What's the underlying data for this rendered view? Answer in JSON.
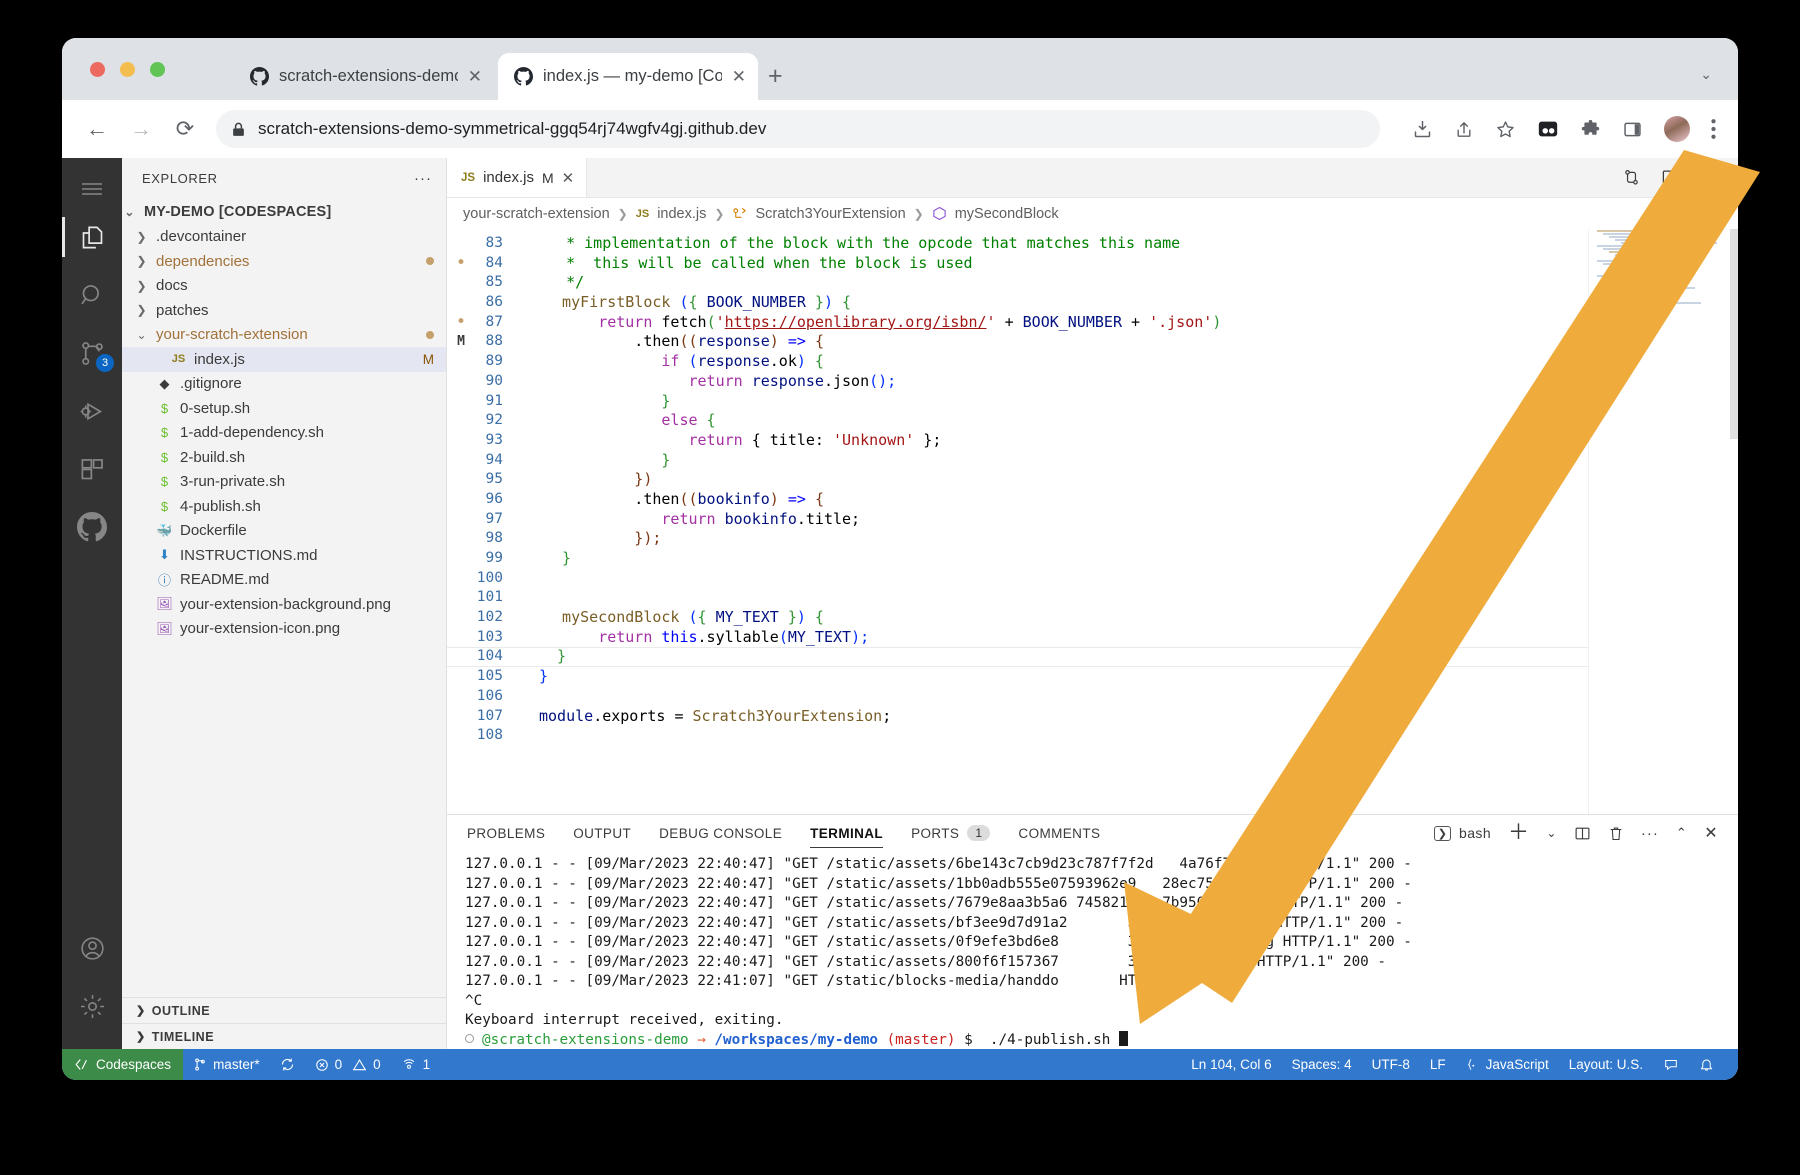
{
  "browser": {
    "tabs": [
      {
        "title": "scratch-extensions-demo/my-d",
        "active": false
      },
      {
        "title": "index.js — my-demo [Codespa",
        "active": true
      }
    ],
    "new_tab_label": "+",
    "tab_close_label": "✕",
    "tab_list_icon": "chevron-down-icon",
    "back_label": "←",
    "forward_label": "→",
    "reload_label": "⟳",
    "lock_icon": "lock-icon",
    "url": "scratch-extensions-demo-symmetrical-ggq54rj74wgfv4gj.github.dev",
    "toolbar_icons": [
      "download-icon",
      "share-icon",
      "bookmark-star-icon",
      "extension-dark-icon",
      "puzzle-icon",
      "sidepanel-icon",
      "avatar",
      "kebab-menu-icon"
    ]
  },
  "activity_bar": {
    "items": [
      {
        "name": "menu",
        "icon": "hamburger-icon",
        "active": false,
        "badge": null
      },
      {
        "name": "explorer",
        "icon": "files-icon",
        "active": true,
        "badge": null
      },
      {
        "name": "search",
        "icon": "search-icon",
        "active": false,
        "badge": null
      },
      {
        "name": "source-control",
        "icon": "source-control-icon",
        "active": false,
        "badge": "3"
      },
      {
        "name": "run-and-debug",
        "icon": "run-debug-icon",
        "active": false,
        "badge": null
      },
      {
        "name": "extensions",
        "icon": "extensions-icon",
        "active": false,
        "badge": null
      },
      {
        "name": "github",
        "icon": "github-icon",
        "active": false,
        "badge": null
      }
    ],
    "bottom_items": [
      {
        "name": "accounts",
        "icon": "account-icon"
      },
      {
        "name": "settings",
        "icon": "gear-icon"
      }
    ]
  },
  "sidebar": {
    "title": "EXPLORER",
    "more_actions": "···",
    "root": "MY-DEMO [CODESPACES]",
    "items": [
      {
        "label": ".devcontainer",
        "type": "folder",
        "expanded": false,
        "indent": 1,
        "icon": "folder",
        "color": "#3b3b3b",
        "badge": null
      },
      {
        "label": "dependencies",
        "type": "folder",
        "expanded": false,
        "indent": 1,
        "icon": "folder",
        "color": "#a1713a",
        "badge": "dirty"
      },
      {
        "label": "docs",
        "type": "folder",
        "expanded": false,
        "indent": 1,
        "icon": "folder",
        "color": "#3b3b3b",
        "badge": null
      },
      {
        "label": "patches",
        "type": "folder",
        "expanded": false,
        "indent": 1,
        "icon": "folder",
        "color": "#3b3b3b",
        "badge": null
      },
      {
        "label": "your-scratch-extension",
        "type": "folder",
        "expanded": true,
        "indent": 1,
        "icon": "folder",
        "color": "#a1713a",
        "badge": "dirty"
      },
      {
        "label": "index.js",
        "type": "file",
        "indent": 2,
        "icon": "js-icon",
        "color": "#3b3b3b",
        "badge": "M",
        "selected": true
      },
      {
        "label": ".gitignore",
        "type": "file",
        "indent": 1,
        "icon": "git-icon",
        "color": "#3b3b3b",
        "badge": null
      },
      {
        "label": "0-setup.sh",
        "type": "file",
        "indent": 1,
        "icon": "shell-icon",
        "color": "#3b3b3b",
        "badge": null
      },
      {
        "label": "1-add-dependency.sh",
        "type": "file",
        "indent": 1,
        "icon": "shell-icon",
        "color": "#3b3b3b",
        "badge": null
      },
      {
        "label": "2-build.sh",
        "type": "file",
        "indent": 1,
        "icon": "shell-icon",
        "color": "#3b3b3b",
        "badge": null
      },
      {
        "label": "3-run-private.sh",
        "type": "file",
        "indent": 1,
        "icon": "shell-icon",
        "color": "#3b3b3b",
        "badge": null
      },
      {
        "label": "4-publish.sh",
        "type": "file",
        "indent": 1,
        "icon": "shell-icon",
        "color": "#3b3b3b",
        "badge": null
      },
      {
        "label": "Dockerfile",
        "type": "file",
        "indent": 1,
        "icon": "docker-icon",
        "color": "#3b3b3b",
        "badge": null
      },
      {
        "label": "INSTRUCTIONS.md",
        "type": "file",
        "indent": 1,
        "icon": "markdown-icon",
        "color": "#3b3b3b",
        "badge": null
      },
      {
        "label": "README.md",
        "type": "file",
        "indent": 1,
        "icon": "info-icon",
        "color": "#3b3b3b",
        "badge": null
      },
      {
        "label": "your-extension-background.png",
        "type": "file",
        "indent": 1,
        "icon": "image-icon",
        "color": "#3b3b3b",
        "badge": null
      },
      {
        "label": "your-extension-icon.png",
        "type": "file",
        "indent": 1,
        "icon": "image-icon",
        "color": "#3b3b3b",
        "badge": null
      }
    ],
    "sections": [
      {
        "label": "OUTLINE",
        "expanded": false
      },
      {
        "label": "TIMELINE",
        "expanded": false
      }
    ]
  },
  "editor": {
    "tab": {
      "filename": "index.js",
      "badge": "M",
      "close": "✕",
      "lang_icon": "JS"
    },
    "actions": [
      "split-editor-icon",
      "more-actions-icon"
    ],
    "breadcrumb": [
      "your-scratch-extension",
      "index.js",
      "Scratch3YourExtension",
      "mySecondBlock"
    ],
    "first_line": 83,
    "current_line": 104,
    "lines": [
      {
        "n": 83,
        "gutter": "",
        "indent": 0,
        "tokens": [
          {
            "t": "   * implementation of the block with the opcode that matches this name",
            "c": "c-com"
          }
        ]
      },
      {
        "n": 84,
        "gutter": "•",
        "indent": 0,
        "tokens": [
          {
            "t": "   *  this will be called when the block is used",
            "c": "c-com"
          }
        ]
      },
      {
        "n": 85,
        "gutter": "",
        "indent": 0,
        "tokens": [
          {
            "t": "   */",
            "c": "c-com"
          }
        ]
      },
      {
        "n": 86,
        "gutter": "",
        "indent": 1,
        "tokens": [
          {
            "t": "  myFirstBlock ",
            "c": "c-fn"
          },
          {
            "t": "(",
            "c": "c-brk1"
          },
          {
            "t": "{ ",
            "c": "c-brk2"
          },
          {
            "t": "BOOK_NUMBER",
            "c": "c-var"
          },
          {
            "t": " }",
            "c": "c-brk2"
          },
          {
            "t": ")",
            "c": "c-brk1"
          },
          {
            "t": " {",
            "c": "c-brk2"
          }
        ]
      },
      {
        "n": 87,
        "gutter": "•",
        "indent": 1,
        "tokens": [
          {
            "t": "      ",
            "c": "c-pl"
          },
          {
            "t": "return",
            "c": "c-kw"
          },
          {
            "t": " fetch",
            "c": "c-pl"
          },
          {
            "t": "(",
            "c": "c-brk2"
          },
          {
            "t": "'",
            "c": "c-str"
          },
          {
            "t": "https://openlibrary.org/isbn/",
            "c": "c-url"
          },
          {
            "t": "'",
            "c": "c-str"
          },
          {
            "t": " + ",
            "c": "c-pl"
          },
          {
            "t": "BOOK_NUMBER",
            "c": "c-var"
          },
          {
            "t": " + ",
            "c": "c-pl"
          },
          {
            "t": "'.json'",
            "c": "c-str"
          },
          {
            "t": ")",
            "c": "c-brk2"
          }
        ]
      },
      {
        "n": 88,
        "gutter": "M",
        "indent": 1,
        "tokens": [
          {
            "t": "          .then",
            "c": "c-pl"
          },
          {
            "t": "((",
            "c": "c-brk3"
          },
          {
            "t": "response",
            "c": "c-var"
          },
          {
            "t": ")",
            "c": "c-brk3"
          },
          {
            "t": " => ",
            "c": "c-kw2"
          },
          {
            "t": "{",
            "c": "c-brk3"
          }
        ]
      },
      {
        "n": 89,
        "gutter": "",
        "indent": 1,
        "tokens": [
          {
            "t": "             ",
            "c": "c-pl"
          },
          {
            "t": "if",
            "c": "c-kw"
          },
          {
            "t": " (",
            "c": "c-brk1"
          },
          {
            "t": "response",
            "c": "c-var"
          },
          {
            "t": ".ok",
            "c": "c-pl"
          },
          {
            "t": ")",
            "c": "c-brk1"
          },
          {
            "t": " {",
            "c": "c-brk2"
          }
        ]
      },
      {
        "n": 90,
        "gutter": "",
        "indent": 1,
        "tokens": [
          {
            "t": "                ",
            "c": "c-pl"
          },
          {
            "t": "return",
            "c": "c-kw"
          },
          {
            "t": " ",
            "c": "c-pl"
          },
          {
            "t": "response",
            "c": "c-var"
          },
          {
            "t": ".json",
            "c": "c-pl"
          },
          {
            "t": "();",
            "c": "c-brk1"
          }
        ]
      },
      {
        "n": 91,
        "gutter": "",
        "indent": 1,
        "tokens": [
          {
            "t": "             }",
            "c": "c-brk2"
          }
        ]
      },
      {
        "n": 92,
        "gutter": "",
        "indent": 1,
        "tokens": [
          {
            "t": "             ",
            "c": "c-pl"
          },
          {
            "t": "else",
            "c": "c-kw"
          },
          {
            "t": " {",
            "c": "c-brk2"
          }
        ]
      },
      {
        "n": 93,
        "gutter": "",
        "indent": 1,
        "tokens": [
          {
            "t": "                ",
            "c": "c-pl"
          },
          {
            "t": "return",
            "c": "c-kw"
          },
          {
            "t": " { title: ",
            "c": "c-pl"
          },
          {
            "t": "'Unknown'",
            "c": "c-str"
          },
          {
            "t": " };",
            "c": "c-pl"
          }
        ]
      },
      {
        "n": 94,
        "gutter": "",
        "indent": 1,
        "tokens": [
          {
            "t": "             }",
            "c": "c-brk2"
          }
        ]
      },
      {
        "n": 95,
        "gutter": "",
        "indent": 1,
        "tokens": [
          {
            "t": "          })",
            "c": "c-brk3"
          }
        ]
      },
      {
        "n": 96,
        "gutter": "",
        "indent": 1,
        "tokens": [
          {
            "t": "          .then",
            "c": "c-pl"
          },
          {
            "t": "((",
            "c": "c-brk3"
          },
          {
            "t": "bookinfo",
            "c": "c-var"
          },
          {
            "t": ")",
            "c": "c-brk3"
          },
          {
            "t": " => ",
            "c": "c-kw2"
          },
          {
            "t": "{",
            "c": "c-brk3"
          }
        ]
      },
      {
        "n": 97,
        "gutter": "",
        "indent": 1,
        "tokens": [
          {
            "t": "             ",
            "c": "c-pl"
          },
          {
            "t": "return",
            "c": "c-kw"
          },
          {
            "t": " ",
            "c": "c-pl"
          },
          {
            "t": "bookinfo",
            "c": "c-var"
          },
          {
            "t": ".title;",
            "c": "c-pl"
          }
        ]
      },
      {
        "n": 98,
        "gutter": "",
        "indent": 1,
        "tokens": [
          {
            "t": "          });",
            "c": "c-brk3"
          }
        ]
      },
      {
        "n": 99,
        "gutter": "",
        "indent": 1,
        "tokens": [
          {
            "t": "  }",
            "c": "c-brk2"
          }
        ]
      },
      {
        "n": 100,
        "gutter": "",
        "indent": 1,
        "tokens": [
          {
            "t": "",
            "c": "c-pl"
          }
        ]
      },
      {
        "n": 101,
        "gutter": "",
        "indent": 1,
        "tokens": [
          {
            "t": "",
            "c": "c-pl"
          }
        ]
      },
      {
        "n": 102,
        "gutter": "",
        "indent": 1,
        "tokens": [
          {
            "t": "  mySecondBlock ",
            "c": "c-fn"
          },
          {
            "t": "(",
            "c": "c-brk1"
          },
          {
            "t": "{ ",
            "c": "c-brk2"
          },
          {
            "t": "MY_TEXT",
            "c": "c-var"
          },
          {
            "t": " }",
            "c": "c-brk2"
          },
          {
            "t": ")",
            "c": "c-brk1"
          },
          {
            "t": " {",
            "c": "c-brk2"
          }
        ]
      },
      {
        "n": 103,
        "gutter": "",
        "indent": 1,
        "tokens": [
          {
            "t": "      ",
            "c": "c-pl"
          },
          {
            "t": "return",
            "c": "c-kw"
          },
          {
            "t": " ",
            "c": "c-pl"
          },
          {
            "t": "this",
            "c": "c-kw2"
          },
          {
            "t": ".syllable",
            "c": "c-pl"
          },
          {
            "t": "(",
            "c": "c-brk1"
          },
          {
            "t": "MY_TEXT",
            "c": "c-var"
          },
          {
            "t": ");",
            "c": "c-brk1"
          }
        ]
      },
      {
        "n": 104,
        "gutter": "",
        "indent": 0,
        "current": true,
        "tokens": [
          {
            "t": "  }",
            "c": "c-brk2"
          }
        ]
      },
      {
        "n": 105,
        "gutter": "",
        "indent": 0,
        "tokens": [
          {
            "t": "}",
            "c": "c-brk1"
          }
        ]
      },
      {
        "n": 106,
        "gutter": "",
        "indent": 0,
        "tokens": [
          {
            "t": "",
            "c": "c-pl"
          }
        ]
      },
      {
        "n": 107,
        "gutter": "",
        "indent": 0,
        "tokens": [
          {
            "t": "module",
            "c": "c-var"
          },
          {
            "t": ".exports = ",
            "c": "c-pl"
          },
          {
            "t": "Scratch3YourExtension",
            "c": "c-fn"
          },
          {
            "t": ";",
            "c": "c-pl"
          }
        ]
      },
      {
        "n": 108,
        "gutter": "",
        "indent": 0,
        "tokens": [
          {
            "t": "",
            "c": "c-pl"
          }
        ]
      }
    ]
  },
  "panel": {
    "tabs": [
      {
        "label": "PROBLEMS",
        "active": false,
        "count": null
      },
      {
        "label": "OUTPUT",
        "active": false,
        "count": null
      },
      {
        "label": "DEBUG CONSOLE",
        "active": false,
        "count": null
      },
      {
        "label": "TERMINAL",
        "active": true,
        "count": null
      },
      {
        "label": "PORTS",
        "active": false,
        "count": "1"
      },
      {
        "label": "COMMENTS",
        "active": false,
        "count": null
      }
    ],
    "shell_label": "bash",
    "actions": [
      "new-terminal-icon",
      "dropdown-icon",
      "split-terminal-icon",
      "trash-icon",
      "more-actions-icon",
      "chevron-up-icon",
      "close-icon"
    ],
    "terminal_lines": [
      "127.0.0.1 - - [09/Mar/2023 22:40:47] \"GET /static/assets/6be143c7cb9d23c787f7f2d   4a76f72.svg HTTP/1.1\" 200 -",
      "127.0.0.1 - - [09/Mar/2023 22:40:47] \"GET /static/assets/1bb0adb555e07593962e9   28ec7566d.svg HTTP/1.1\" 200 -",
      "127.0.0.1 - - [09/Mar/2023 22:40:47] \"GET /static/assets/7679e8aa3b5a6 745821  0a7b950065.png HTTP/1.1\" 200 -",
      "127.0.0.1 - - [09/Mar/2023 22:40:47] \"GET /static/assets/bf3ee9d7d91a2       3f88f6799425.png HTTP/1.1\" 200 -",
      "127.0.0.1 - - [09/Mar/2023 22:40:47] \"GET /static/assets/0f9efe3bd6e8        3aeb9e19997b5.svg HTTP/1.1\" 200 -",
      "127.0.0.1 - - [09/Mar/2023 22:40:47] \"GET /static/assets/800f6f157367        3164602287.svg HTTP/1.1\" 200 -",
      "127.0.0.1 - - [09/Mar/2023 22:41:07] \"GET /static/blocks-media/handdo       HTTP/1.1\" 200 -",
      "^C",
      "Keyboard interrupt received, exiting."
    ],
    "prompt": {
      "user": "@scratch-extensions-demo",
      "arrow": "→",
      "path": "/workspaces/my-demo",
      "branch": "(master)",
      "sigil": "$",
      "command": "./4-publish.sh"
    }
  },
  "statusbar": {
    "codespaces_label": "Codespaces",
    "branch": "master*",
    "sync_icon": "sync-icon",
    "errors": "0",
    "warnings": "0",
    "ports": "1",
    "position": "Ln 104, Col 6",
    "spaces": "Spaces: 4",
    "encoding": "UTF-8",
    "eol": "LF",
    "language": "JavaScript",
    "layout": "Layout: U.S.",
    "feedback_icon": "feedback-icon",
    "bell_icon": "bell-icon"
  },
  "annotation": {
    "arrow_color": "#efab3c"
  }
}
